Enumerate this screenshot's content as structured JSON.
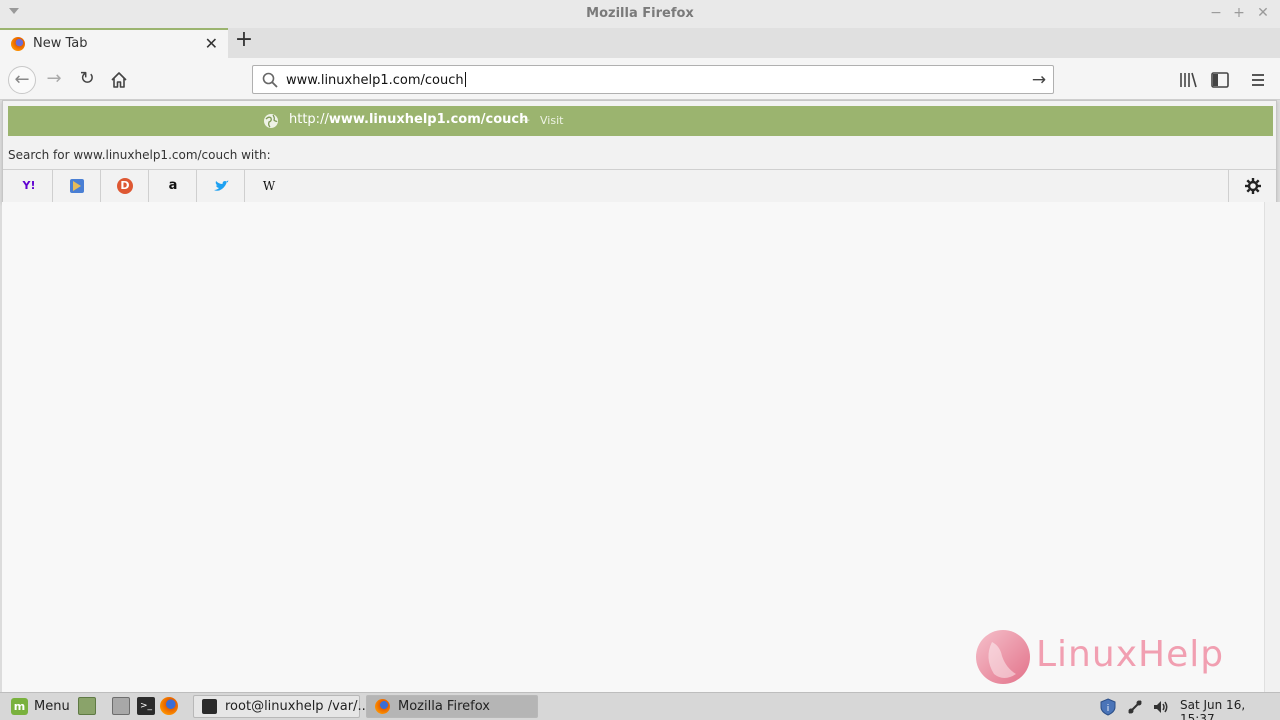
{
  "window": {
    "title": "Mozilla Firefox"
  },
  "tab": {
    "title": "New Tab",
    "close_glyph": "✕",
    "new_tab_glyph": "+"
  },
  "nav": {
    "back_glyph": "←",
    "forward_glyph": "→",
    "reload_glyph": "↻",
    "go_glyph": "→"
  },
  "urlbar": {
    "value": "www.linuxhelp1.com/couch"
  },
  "autocomplete": {
    "url_prefix": "http://",
    "url_bold": "www.linuxhelp1.com/couch",
    "separator": "—",
    "action": "Visit",
    "search_with_label": "Search for www.linuxhelp1.com/couch with:"
  },
  "search_engines": [
    {
      "name": "Yahoo",
      "icon": "yahoo-icon",
      "glyph": "Y!"
    },
    {
      "name": "Bing",
      "icon": "bing-icon",
      "glyph": ""
    },
    {
      "name": "DuckDuckGo",
      "icon": "duckduckgo-icon",
      "glyph": "D"
    },
    {
      "name": "Amazon",
      "icon": "amazon-icon",
      "glyph": "a"
    },
    {
      "name": "Twitter",
      "icon": "twitter-icon",
      "glyph": ""
    },
    {
      "name": "Wikipedia",
      "icon": "wikipedia-icon",
      "glyph": "W"
    }
  ],
  "watermark": {
    "text": "LinuxHelp"
  },
  "taskbar": {
    "menu_label": "Menu",
    "tasks": [
      {
        "label": "root@linuxhelp /var/...",
        "icon": "terminal-icon"
      },
      {
        "label": "Mozilla Firefox",
        "icon": "firefox-icon"
      }
    ],
    "clock": "Sat Jun 16, 15:37"
  },
  "colors": {
    "accent": "#9bb46f",
    "mint": "#79b13d"
  }
}
